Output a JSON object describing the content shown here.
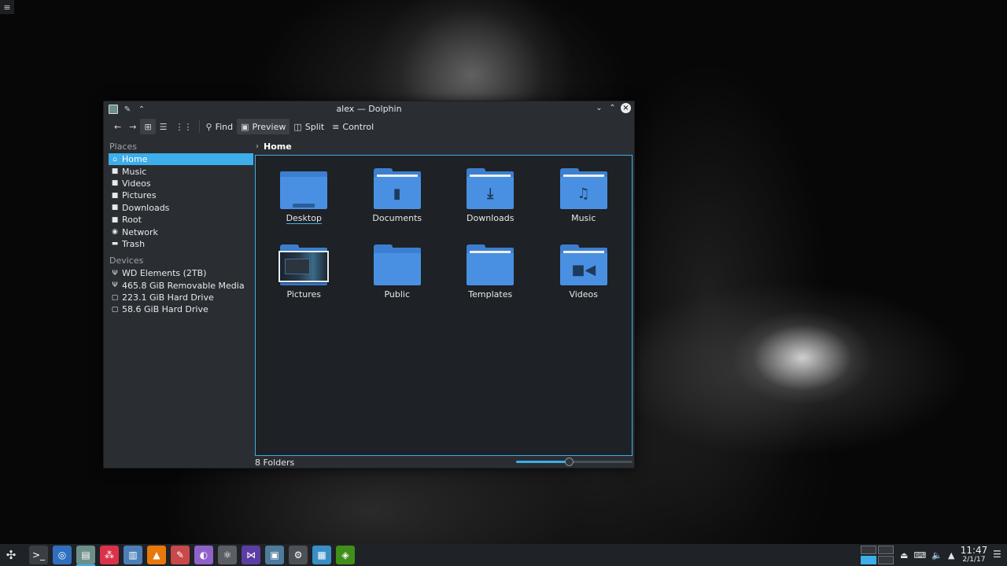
{
  "desktop": {
    "corner_menu": "≡"
  },
  "window": {
    "title": "alex — Dolphin",
    "toolbar": {
      "back": "←",
      "forward": "→",
      "view_icons": "⊞",
      "view_details": "☰",
      "view_compact": "⋮⋮",
      "find": "Find",
      "preview": "Preview",
      "split": "Split",
      "control": "Control"
    },
    "places": {
      "heading": "Places",
      "items": [
        {
          "label": "Home",
          "icon": "home-icon"
        },
        {
          "label": "Music",
          "icon": "folder-icon"
        },
        {
          "label": "Videos",
          "icon": "folder-icon"
        },
        {
          "label": "Pictures",
          "icon": "folder-icon"
        },
        {
          "label": "Downloads",
          "icon": "folder-icon"
        },
        {
          "label": "Root",
          "icon": "folder-icon"
        },
        {
          "label": "Network",
          "icon": "network-icon"
        },
        {
          "label": "Trash",
          "icon": "trash-icon"
        }
      ]
    },
    "devices": {
      "heading": "Devices",
      "items": [
        {
          "label": "WD Elements (2TB)",
          "icon": "usb-icon"
        },
        {
          "label": "465.8 GiB Removable Media",
          "icon": "usb-icon"
        },
        {
          "label": "223.1 GiB Hard Drive",
          "icon": "drive-icon"
        },
        {
          "label": "58.6 GiB Hard Drive",
          "icon": "drive-icon"
        }
      ]
    },
    "breadcrumb": {
      "current": "Home"
    },
    "folders": [
      {
        "name": "Desktop",
        "icon": "folder-desktop-icon"
      },
      {
        "name": "Documents",
        "icon": "folder-documents-icon"
      },
      {
        "name": "Downloads",
        "icon": "folder-downloads-icon"
      },
      {
        "name": "Music",
        "icon": "folder-music-icon"
      },
      {
        "name": "Pictures",
        "icon": "folder-pictures-icon"
      },
      {
        "name": "Public",
        "icon": "folder-icon"
      },
      {
        "name": "Templates",
        "icon": "folder-templates-icon"
      },
      {
        "name": "Videos",
        "icon": "folder-videos-icon"
      }
    ],
    "status": {
      "summary": "8 Folders",
      "zoom_level": 0.45
    }
  },
  "taskbar": {
    "apps": [
      {
        "name": "terminal",
        "color": "#3a3f45"
      },
      {
        "name": "chrome",
        "color": "#2f6fbf"
      },
      {
        "name": "dolphin",
        "color": "#6d8f8a"
      },
      {
        "name": "kdeconnect",
        "color": "#d9324a"
      },
      {
        "name": "store",
        "color": "#4c7fb8"
      },
      {
        "name": "vlc",
        "color": "#e8780b"
      },
      {
        "name": "editor",
        "color": "#c94848"
      },
      {
        "name": "paint",
        "color": "#8f62c9"
      },
      {
        "name": "atom",
        "color": "#5b5f63"
      },
      {
        "name": "visual-studio",
        "color": "#5c3ea3"
      },
      {
        "name": "screenshot",
        "color": "#4f7b9c"
      },
      {
        "name": "settings",
        "color": "#4d5156"
      },
      {
        "name": "media",
        "color": "#3a8ec4"
      },
      {
        "name": "nvidia",
        "color": "#3f8f1a"
      }
    ],
    "clock": {
      "time": "11:47",
      "date": "2/1/17"
    }
  }
}
